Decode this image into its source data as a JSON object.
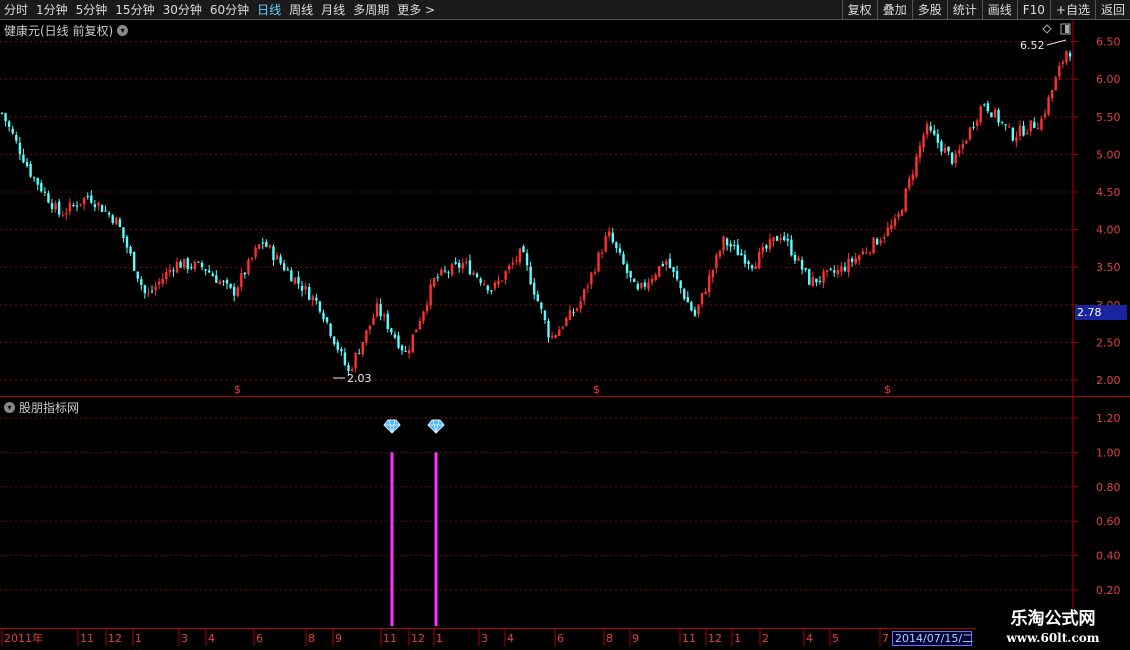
{
  "toolbar": {
    "periods": [
      "分时",
      "1分钟",
      "5分钟",
      "15分钟",
      "30分钟",
      "60分钟",
      "日线",
      "周线",
      "月线",
      "多周期",
      "更多 >"
    ],
    "active_period": "日线",
    "right_buttons": [
      "复权",
      "叠加",
      "多股",
      "统计",
      "画线",
      "F10",
      "+自选",
      "返回"
    ]
  },
  "main_panel": {
    "title": "健康元(日线 前复权)",
    "high_marker": "6.52",
    "low_marker": "2.03",
    "current_price": "2.78",
    "y_ticks": [
      "6.50",
      "6.00",
      "5.50",
      "5.00",
      "4.50",
      "4.00",
      "3.50",
      "3.00",
      "2.50",
      "2.00"
    ],
    "s_marker": "$"
  },
  "indicator_panel": {
    "title": "股朋指标网",
    "y_ticks": [
      "1.20",
      "1.00",
      "0.80",
      "0.60",
      "0.40",
      "0.20"
    ]
  },
  "x_axis": {
    "labels": [
      "2011年",
      "11",
      "12",
      "1",
      "3",
      "4",
      "6",
      "8",
      "9",
      "11",
      "12",
      "1",
      "3",
      "4",
      "6",
      "8",
      "9",
      "11",
      "12",
      "1",
      "2",
      "4",
      "5",
      "7"
    ],
    "selected_date": "2014/07/15/二"
  },
  "watermark": {
    "line1": "乐淘公式网",
    "line2": "www.60lt.com"
  },
  "colors": {
    "up": "#ff3030",
    "down": "#54ffff",
    "signal": "#ff33ff",
    "grid": "#8a0000",
    "axis": "#b00000"
  },
  "chart_data": [
    {
      "type": "line",
      "title": "健康元(日线 前复权)",
      "y_scale_ticks": [
        6.5,
        6.0,
        5.5,
        5.0,
        4.5,
        4.0,
        3.5,
        3.0,
        2.5,
        2.0
      ],
      "ylim": [
        1.9,
        6.7
      ],
      "x": [
        "2011年",
        "11",
        "12",
        "1",
        "3",
        "4",
        "6",
        "8",
        "9",
        "11",
        "12",
        "1",
        "3",
        "4",
        "6",
        "8",
        "9",
        "11",
        "12",
        "1",
        "2",
        "4",
        "5",
        "7"
      ],
      "series": [
        {
          "values": [
            5.55,
            4.75,
            4.2,
            4.45,
            4.1,
            3.1,
            3.55,
            3.5,
            3.15,
            3.85,
            3.4,
            3.0,
            2.1,
            2.95,
            2.35,
            3.35,
            3.55,
            3.2,
            3.7,
            2.55,
            3.0,
            3.95,
            3.15,
            3.6,
            2.85,
            3.85,
            3.55,
            3.95,
            3.3,
            3.45,
            3.75,
            4.1,
            5.35,
            4.9,
            5.7,
            5.25,
            5.45,
            6.52
          ]
        }
      ],
      "annotations": [
        "6.52",
        "2.03",
        "2.78"
      ]
    },
    {
      "type": "bar",
      "title": "股朋指标网",
      "ylim": [
        0.1,
        1.3
      ],
      "y_scale_ticks": [
        1.2,
        1.0,
        0.8,
        0.6,
        0.4,
        0.2
      ],
      "signals": [
        {
          "x_label": "11",
          "value": 1.0
        },
        {
          "x_label": "1",
          "value": 1.0
        }
      ]
    }
  ]
}
